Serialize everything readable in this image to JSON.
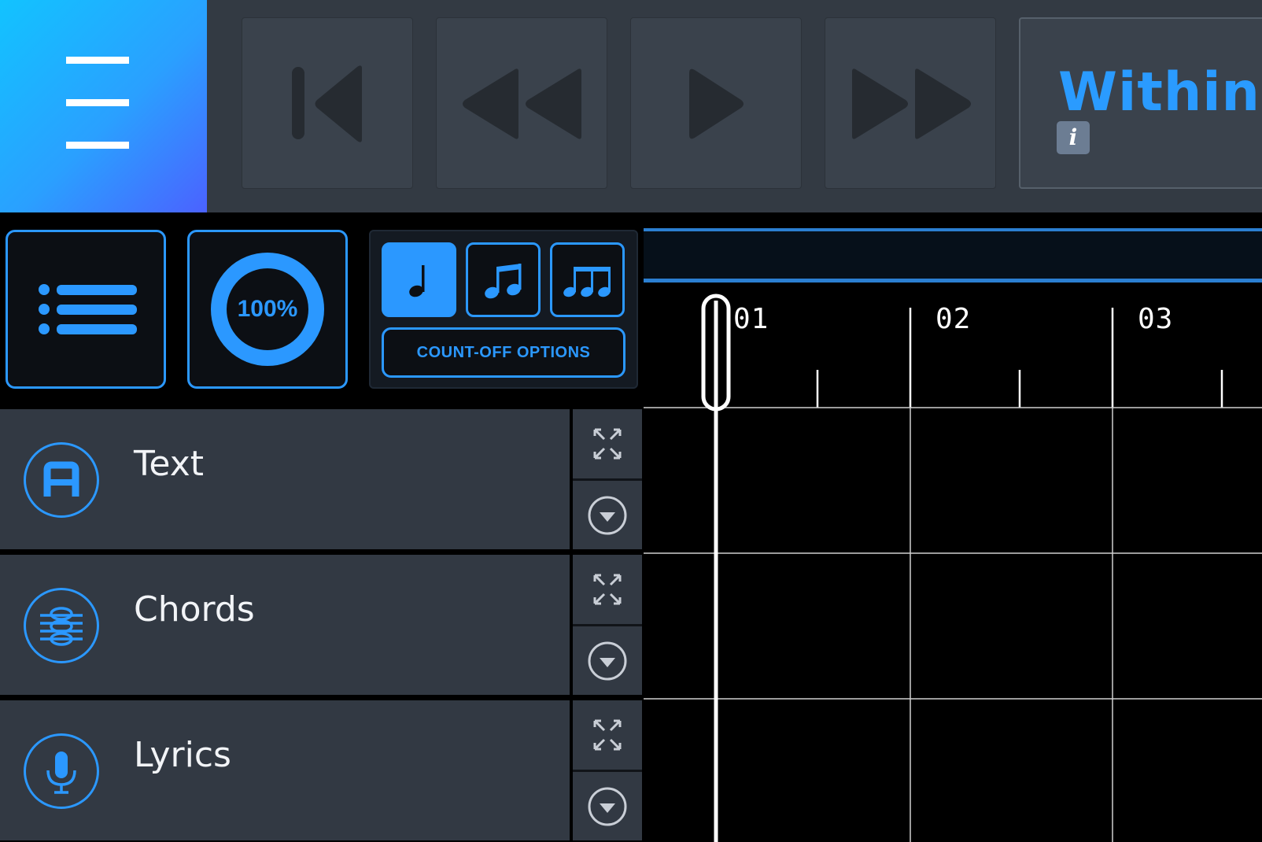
{
  "menu": {
    "icon": "hamburger-menu-icon"
  },
  "transport": {
    "buttons": [
      {
        "name": "skip-to-start",
        "icon": "skip-to-start-icon"
      },
      {
        "name": "rewind",
        "icon": "rewind-icon"
      },
      {
        "name": "play",
        "icon": "play-icon"
      },
      {
        "name": "fast-forward",
        "icon": "fast-forward-icon"
      }
    ]
  },
  "song": {
    "title": "Within",
    "info_label": "i"
  },
  "controls": {
    "setlist_icon": "list-icon",
    "tempo_percent": "100%",
    "count_off": {
      "notes": [
        {
          "icon": "quarter-note-icon",
          "active": true
        },
        {
          "icon": "eighth-notes-icon",
          "active": false
        },
        {
          "icon": "triplet-notes-icon",
          "active": false
        }
      ],
      "options_label": "COUNT-OFF OPTIONS"
    }
  },
  "tracks": [
    {
      "label": "Text",
      "icon": "text-track-icon"
    },
    {
      "label": "Chords",
      "icon": "chords-track-icon"
    },
    {
      "label": "Lyrics",
      "icon": "microphone-icon"
    }
  ],
  "timeline": {
    "bars": [
      "01",
      "02",
      "03"
    ]
  },
  "colors": {
    "accent": "#2b98ff",
    "panel": "#323943",
    "topbar": "#333a43",
    "button": "#3a424c"
  }
}
